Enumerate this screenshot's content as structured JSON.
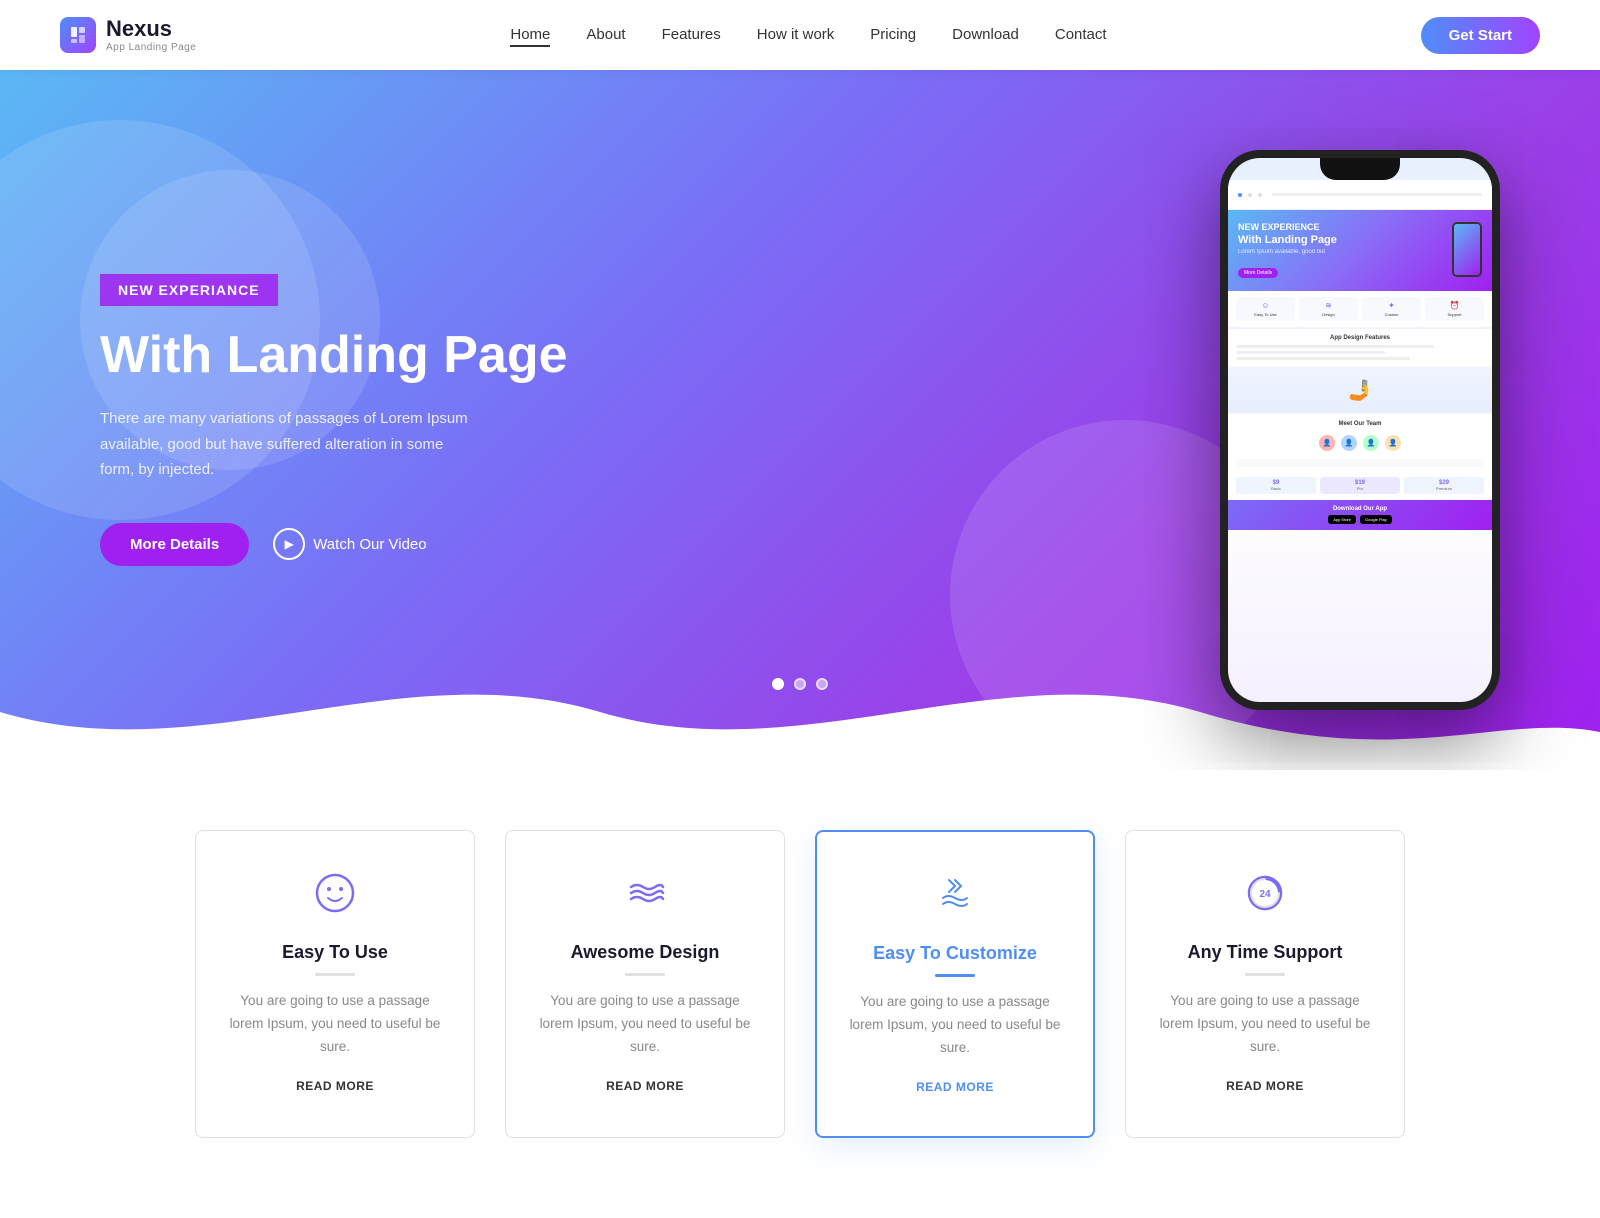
{
  "brand": {
    "name": "Nexus",
    "subtitle": "App Landing Page",
    "icon_symbol": "📱"
  },
  "nav": {
    "links": [
      {
        "label": "Home",
        "href": "#",
        "active": true
      },
      {
        "label": "About",
        "href": "#",
        "active": false
      },
      {
        "label": "Features",
        "href": "#",
        "active": false
      },
      {
        "label": "How it work",
        "href": "#",
        "active": false
      },
      {
        "label": "Pricing",
        "href": "#",
        "active": false
      },
      {
        "label": "Download",
        "href": "#",
        "active": false
      },
      {
        "label": "Contact",
        "href": "#",
        "active": false
      }
    ],
    "cta_label": "Get Start"
  },
  "hero": {
    "badge": "NEW EXPERIANCE",
    "title": "With Landing Page",
    "description": "There are many variations of passages of Lorem Ipsum available, good but have suffered alteration in some form, by injected.",
    "btn_details": "More Details",
    "btn_video": "Watch Our Video",
    "dots": [
      {
        "active": true
      },
      {
        "active": false
      },
      {
        "active": false
      }
    ]
  },
  "features": [
    {
      "icon": "☺",
      "title": "Easy To Use",
      "description": "You are going to use a passage lorem Ipsum, you need to useful be sure.",
      "read_more": "READ MORE",
      "highlighted": false,
      "blue": false
    },
    {
      "icon": "≋",
      "title": "Awesome Design",
      "description": "You are going to use a passage lorem Ipsum, you need to useful be sure.",
      "read_more": "READ MORE",
      "highlighted": false,
      "blue": false
    },
    {
      "icon": "🤲",
      "title": "Easy To Customize",
      "description": "You are going to use a passage lorem Ipsum, you need to useful be sure.",
      "read_more": "READ MORE",
      "highlighted": true,
      "blue": true
    },
    {
      "icon": "⏰",
      "title": "Any Time Support",
      "description": "You are going to use a passage lorem Ipsum, you need to useful be sure.",
      "read_more": "READ MORE",
      "highlighted": false,
      "blue": false
    }
  ]
}
